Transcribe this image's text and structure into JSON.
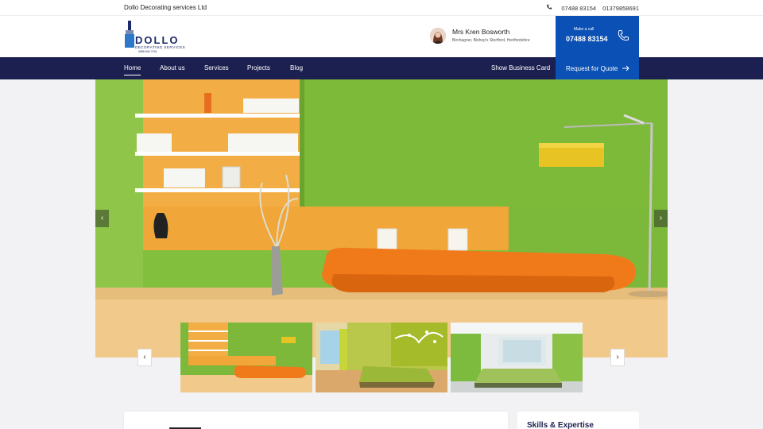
{
  "topbar": {
    "company": "Dollo Decorating services Ltd",
    "phone1": "07488 83154",
    "phone2": "01379858691"
  },
  "header": {
    "logo": {
      "word": "DOLLO",
      "sub": "DECORATING SERVICES",
      "num": "0888 846 7216"
    },
    "contact": {
      "name": "Mrs Kren Bosworth",
      "address": "Birchagner, Bishop's Stortford, Hertfordshire"
    },
    "call": {
      "label": "Make a call",
      "number": "07488 83154"
    }
  },
  "nav": {
    "items": [
      "Home",
      "About us",
      "Services",
      "Projects",
      "Blog"
    ],
    "active": "Home",
    "business_card": "Show Business Card",
    "quote": "Request for Quote"
  },
  "hero": {
    "prev": "‹",
    "next": "›"
  },
  "thumbs": {
    "prev": "‹",
    "next": "›"
  },
  "sections": {
    "skills_title": "Skills & Expertise"
  },
  "colors": {
    "navy": "#1c2050",
    "blue": "#0b51b5",
    "green": "#7cb83a",
    "orange": "#f07a1a"
  }
}
